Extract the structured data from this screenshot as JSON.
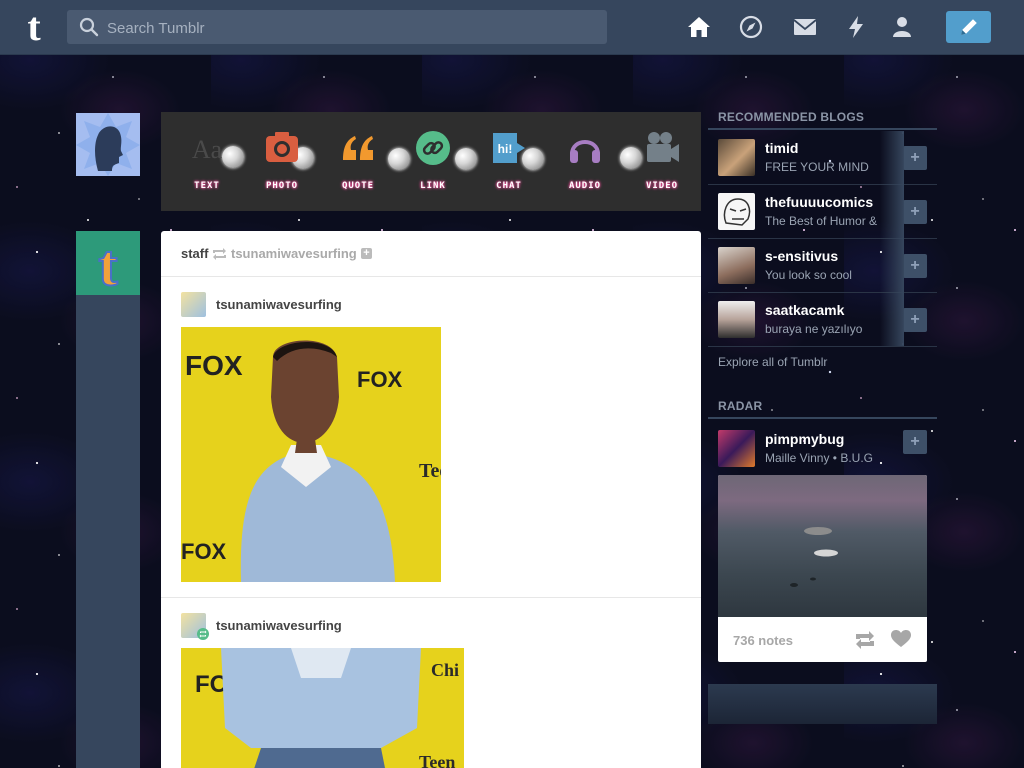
{
  "header": {
    "search_placeholder": "Search Tumblr",
    "brand_color": "#36465d",
    "accent": "#529ecc"
  },
  "post_bar": {
    "items": [
      {
        "label": "TEXT",
        "icon": "text-icon",
        "color": "#444444"
      },
      {
        "label": "PHOTO",
        "icon": "camera-icon",
        "color": "#d95e40"
      },
      {
        "label": "QUOTE",
        "icon": "quote-icon",
        "color": "#f2992e"
      },
      {
        "label": "LINK",
        "icon": "link-icon",
        "color": "#56bc8a"
      },
      {
        "label": "CHAT",
        "icon": "chat-icon",
        "color": "#529ecc"
      },
      {
        "label": "AUDIO",
        "icon": "headphones-icon",
        "color": "#a77dc2"
      },
      {
        "label": "VIDEO",
        "icon": "video-camera-icon",
        "color": "#748089"
      }
    ]
  },
  "post": {
    "reblogger": "staff",
    "reblogged_from": "tsunamiwavesurfing",
    "entries": [
      {
        "author": "tsunamiwavesurfing"
      },
      {
        "author": "tsunamiwavesurfing"
      }
    ]
  },
  "sidebar": {
    "recommended_title": "RECOMMENDED BLOGS",
    "blogs": [
      {
        "name": "timid",
        "desc": "FREE YOUR MIND"
      },
      {
        "name": "thefuuuucomics",
        "desc": "The Best of Humor &"
      },
      {
        "name": "s-ensitivus",
        "desc": "You look so cool"
      },
      {
        "name": "saatkacamk",
        "desc": "buraya ne yazılıyo"
      }
    ],
    "explore_label": "Explore all of Tumblr",
    "radar_title": "RADAR",
    "radar": {
      "name": "pimpmybug",
      "desc": "Maille Vinny • B.U.G",
      "notes": "736 notes"
    }
  }
}
